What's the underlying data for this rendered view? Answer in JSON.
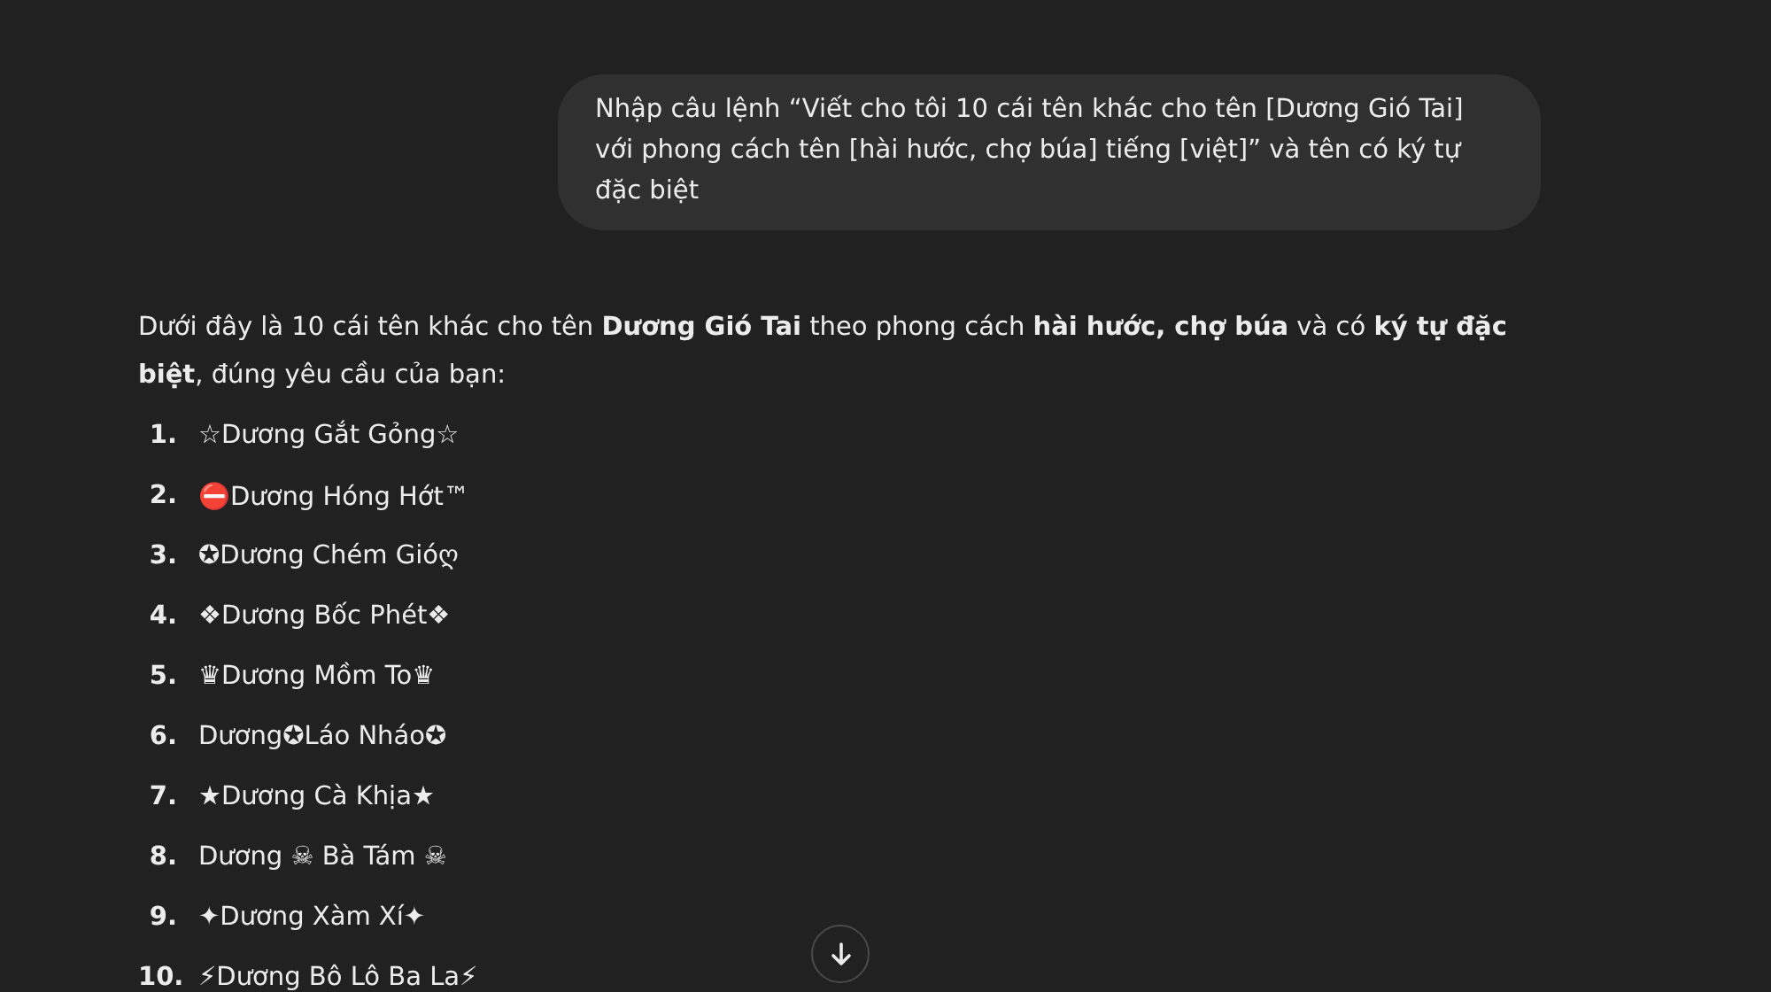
{
  "user_message": "Nhập câu lệnh “Viết cho tôi 10 cái tên khác cho tên [Dương Gió Tai] với phong cách tên [hài hước, chợ búa] tiếng [việt]” và tên có ký tự đặc biệt",
  "reply": {
    "intro": "Dưới đây là 10 cái tên khác cho tên **Dương Gió Tai** theo phong cách **hài hước, chợ búa** và có **ký tự đặc biệt**, đúng yêu cầu của bạn:",
    "items": [
      {
        "number": "1.",
        "text": "☆Dương Gắt Gỏng☆"
      },
      {
        "number": "2.",
        "text": "⛔Dương Hóng Hớt™"
      },
      {
        "number": "3.",
        "text": "✪Dương Chém Gióღ"
      },
      {
        "number": "4.",
        "text": "❖Dương Bốc Phét❖"
      },
      {
        "number": "5.",
        "text": "♛Dương Mồm To♛"
      },
      {
        "number": "6.",
        "text": "Dương✪Láo Nháo✪"
      },
      {
        "number": "7.",
        "text": "★Dương Cà Khịa★"
      },
      {
        "number": "8.",
        "text": "Dương ☠ Bà Tám ☠"
      },
      {
        "number": "9.",
        "text": "✦Dương Xàm Xí✦"
      },
      {
        "number": "10.",
        "text": "⚡Dương Bô Lô Ba La⚡"
      }
    ]
  },
  "scroll_button": {
    "kind": "down"
  }
}
